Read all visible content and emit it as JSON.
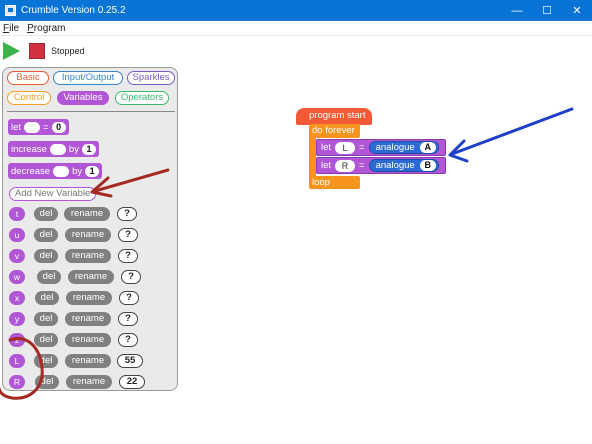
{
  "window": {
    "title": "Crumble Version 0.25.2",
    "minimize_glyph": "—",
    "maximize_glyph": "☐",
    "close_glyph": "✕"
  },
  "menu": {
    "file_first": "F",
    "file_rest": "ile",
    "program_first": "P",
    "program_rest": "rogram"
  },
  "toolbar": {
    "run_icon": "play-triangle",
    "stop_icon": "stop-square",
    "status": "Stopped"
  },
  "categories": [
    {
      "label": "Basic",
      "color": "#e8593c"
    },
    {
      "label": "Input/Output",
      "color": "#3a86c8"
    },
    {
      "label": "Sparkles",
      "color": "#7a5cc4"
    },
    {
      "label": "Control",
      "color": "#f2a023"
    },
    {
      "label": "Variables",
      "color": "#b157d6",
      "selected": true
    },
    {
      "label": "Operators",
      "color": "#3dbb6c"
    }
  ],
  "palette": {
    "let_label": "let",
    "let_eq": "=",
    "let_value": "0",
    "increase_label": "increase",
    "increase_by": "by",
    "increase_value": "1",
    "decrease_label": "decrease",
    "decrease_by": "by",
    "decrease_value": "1",
    "add_variable": "Add New Variable"
  },
  "variables": [
    {
      "name": "t",
      "del": "del",
      "rename": "rename",
      "value": "?"
    },
    {
      "name": "u",
      "del": "del",
      "rename": "rename",
      "value": "?"
    },
    {
      "name": "v",
      "del": "del",
      "rename": "rename",
      "value": "?"
    },
    {
      "name": "w",
      "del": "del",
      "rename": "rename",
      "value": "?"
    },
    {
      "name": "x",
      "del": "del",
      "rename": "rename",
      "value": "?"
    },
    {
      "name": "y",
      "del": "del",
      "rename": "rename",
      "value": "?"
    },
    {
      "name": "z",
      "del": "del",
      "rename": "rename",
      "value": "?"
    },
    {
      "name": "L",
      "del": "del",
      "rename": "rename",
      "value": "55"
    },
    {
      "name": "R",
      "del": "del",
      "rename": "rename",
      "value": "22"
    }
  ],
  "script": {
    "program_start": "program start",
    "do_forever": "do forever",
    "loop": "loop",
    "lines": [
      {
        "let": "let",
        "var": "L",
        "eq": "=",
        "func": "analogue",
        "port": "A"
      },
      {
        "let": "let",
        "var": "R",
        "eq": "=",
        "func": "analogue",
        "port": "B"
      }
    ]
  },
  "colors": {
    "title_bar": "#0a74d6",
    "variables": "#b157d6",
    "program_start": "#f15a35",
    "control": "#f7941d",
    "analogue": "#2b6cd4",
    "annotation_red": "#a52a22",
    "annotation_blue": "#1e3fc8"
  }
}
